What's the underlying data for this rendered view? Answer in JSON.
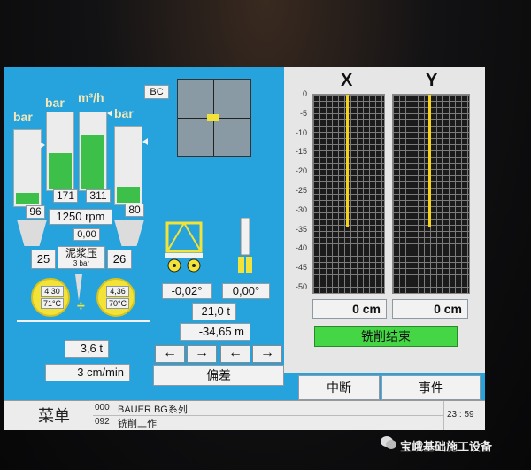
{
  "units": {
    "bar": "bar",
    "m3h": "m³/h"
  },
  "buttons": {
    "bc": "BC",
    "cut_end": "铣削结束",
    "interrupt": "中断",
    "event": "事件",
    "deviation": "偏差",
    "menu": "菜单"
  },
  "gauges": {
    "left_outer": {
      "value": "96",
      "level": 0.15
    },
    "left_inner": {
      "value": "171",
      "level": 0.45
    },
    "flow": {
      "value": "311",
      "level": 0.68
    },
    "right_outer": {
      "value": "80",
      "level": 0.2
    }
  },
  "rpm": "1250 rpm",
  "center_value": "0,00",
  "mud_pressure_label": "泥浆压",
  "mud_pressure_sub": "3 bar",
  "left_value": "25",
  "right_value": "26",
  "pump_left": {
    "pressure": "4,30",
    "temp": "71°C"
  },
  "pump_right": {
    "pressure": "4,36",
    "temp": "70°C"
  },
  "divider_symbol": "÷",
  "angle_left": "-0,02°",
  "angle_right": "0,00°",
  "load": "21,0 t",
  "depth": "-34,65 m",
  "weight": "3,6 t",
  "speed": "3 cm/min",
  "arrows": [
    "←",
    "→",
    "←",
    "→"
  ],
  "xy": {
    "x_label": "X",
    "y_label": "Y",
    "ticks": [
      "0",
      "-5",
      "-10",
      "-15",
      "-20",
      "-25",
      "-30",
      "-35",
      "-40",
      "-45",
      "-50"
    ],
    "x_value": "0 cm",
    "y_value": "0 cm",
    "line_color": "#f5d21c"
  },
  "status": {
    "line1_code": "000",
    "line1_text": "BAUER  BG系列",
    "line2_code": "092",
    "line2_text": "铣削工作",
    "time": "23 : 59"
  },
  "watermark": "宝峨基础施工设备"
}
